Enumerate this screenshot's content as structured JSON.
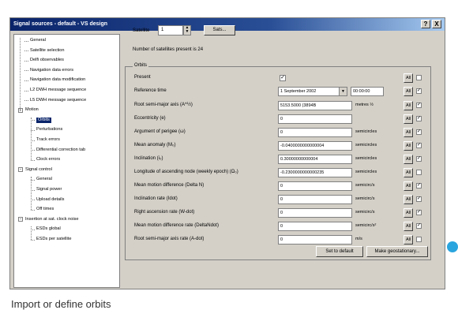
{
  "window": {
    "title": "Signal sources - default - VS design",
    "help_label": "?",
    "close_label": "X"
  },
  "tree": {
    "items": [
      {
        "label": "General",
        "level": 1
      },
      {
        "label": "Satellite selection",
        "level": 1
      },
      {
        "label": "Delfi observables",
        "level": 1
      },
      {
        "label": "Navigation data errors",
        "level": 1
      },
      {
        "label": "Navigation data modification",
        "level": 1
      },
      {
        "label": "L2 DWH message sequence",
        "level": 1
      },
      {
        "label": "L5 DWH message sequence",
        "level": 1
      },
      {
        "label": "Motion",
        "level": 0,
        "expander": "-"
      },
      {
        "label": "Orbits",
        "level": 2,
        "selected": true
      },
      {
        "label": "Perturbations",
        "level": 2
      },
      {
        "label": "Track errors",
        "level": 2
      },
      {
        "label": "Differential correction tab",
        "level": 2
      },
      {
        "label": "Clock errors",
        "level": 2
      },
      {
        "label": "Signal control",
        "level": 0,
        "expander": "-"
      },
      {
        "label": "General",
        "level": 2
      },
      {
        "label": "Signal power",
        "level": 2
      },
      {
        "label": "Upload details",
        "level": 2
      },
      {
        "label": "Off times",
        "level": 2
      },
      {
        "label": "Insertion at sat. clock noise",
        "level": 0,
        "expander": "-"
      },
      {
        "label": "ESDs global",
        "level": 2
      },
      {
        "label": "ESDs per satellite",
        "level": 2
      }
    ]
  },
  "satellite": {
    "label": "Satellite",
    "value": "1",
    "button_label": "Sats..."
  },
  "satellite_count_text": "Number of satellites present is 24",
  "orbits": {
    "group_title": "Orbits",
    "present_label": "Present",
    "present_checked": "✓",
    "reference_time_label": "Reference time",
    "reference_date": "1 September 2002",
    "reference_clock": "00:00:00",
    "all_label": "All",
    "rows": [
      {
        "name": "Root semi-major axis (A^½)",
        "value": "5153.5000 (3894B",
        "unit": "metres ½"
      },
      {
        "name": "Eccentricity (e)",
        "value": "0",
        "unit": ""
      },
      {
        "name": "Argument of perigee (ω)",
        "value": "0",
        "unit": "semicircles"
      },
      {
        "name": "Mean anomaly (M₀)",
        "value": "-0.0400000000000004",
        "unit": "semicircles"
      },
      {
        "name": "Inclination (i₀)",
        "value": "0.30000000000004",
        "unit": "semicircles"
      },
      {
        "name": "Longitude of ascending node (weekly epoch) (Ω₀)",
        "value": "-0.2300000000000235",
        "unit": "semicircles"
      },
      {
        "name": "Mean motion difference (Delta N)",
        "value": "0",
        "unit": "semicirc/s"
      },
      {
        "name": "Inclination rate (Idot)",
        "value": "0",
        "unit": "semicirc/s"
      },
      {
        "name": "Right ascension rate (W-dot)",
        "value": "0",
        "unit": "semicirc/s"
      },
      {
        "name": "Mean motion difference rate (DeltaNdot)",
        "value": "0",
        "unit": "semicirc/s²"
      },
      {
        "name": "Root semi-major axis rate (A-dot)",
        "value": "0",
        "unit": "m/s"
      }
    ],
    "checkbox_states": [
      "",
      "✓",
      "✓",
      "✓",
      "✓",
      "✓",
      "✓",
      "",
      "✓",
      "✓",
      "✓",
      "✓"
    ],
    "set_default_label": "Set to default",
    "make_geo_label": "Make geostationary..."
  },
  "caption": "Import or define orbits",
  "colors": {
    "accent_dot": "#2aa5de",
    "title_bar": "#0a246a",
    "window_bg": "#d4d0c8"
  }
}
